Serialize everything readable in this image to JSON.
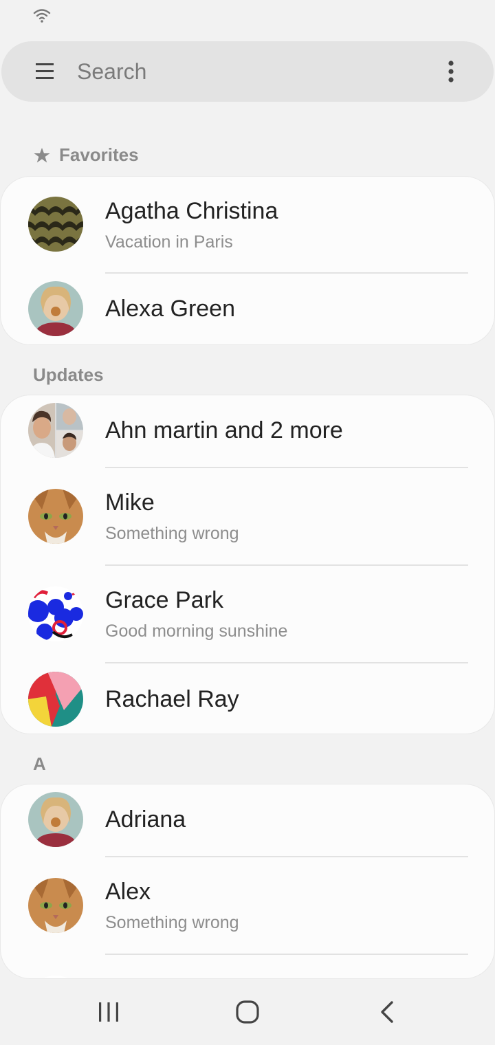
{
  "search": {
    "placeholder": "Search"
  },
  "sections": {
    "favorites": {
      "label": "Favorites",
      "contacts": [
        {
          "name": "Agatha Christina",
          "status": "Vacation in Paris"
        },
        {
          "name": "Alexa Green",
          "status": ""
        }
      ]
    },
    "updates": {
      "label": "Updates",
      "contacts": [
        {
          "name": "Ahn martin and 2 more",
          "status": ""
        },
        {
          "name": "Mike",
          "status": "Something wrong"
        },
        {
          "name": "Grace Park",
          "status": "Good morning sunshine"
        },
        {
          "name": "Rachael Ray",
          "status": ""
        }
      ]
    },
    "a": {
      "label": "A",
      "contacts": [
        {
          "name": "Adriana",
          "status": ""
        },
        {
          "name": "Alex",
          "status": "Something wrong"
        }
      ]
    }
  },
  "icons": {
    "status": "wifi-icon",
    "menu": "hamburger-menu-icon",
    "more": "more-vertical-icon",
    "favorites": "star-icon",
    "nav_recents": "recents-icon",
    "nav_home": "home-icon",
    "nav_back": "back-icon"
  },
  "colors": {
    "background": "#f2f2f2",
    "card": "#fcfcfc",
    "search_bar": "#e3e3e3",
    "section_label": "#8a8a8a",
    "secondary_text": "#8d8d8d"
  }
}
